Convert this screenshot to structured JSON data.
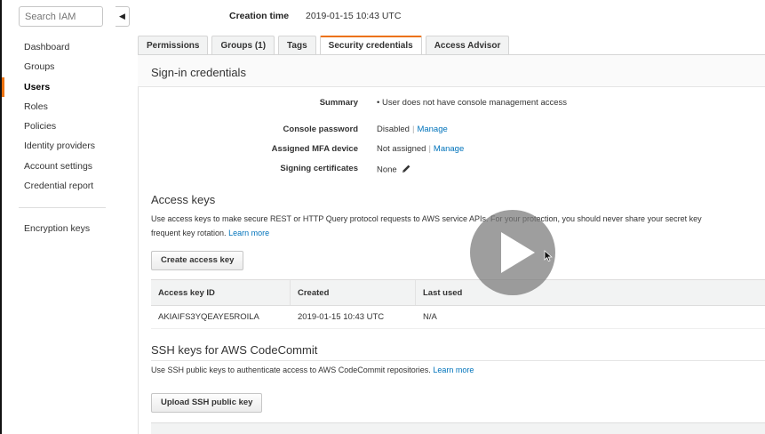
{
  "sidebar": {
    "search_placeholder": "Search IAM",
    "collapse_glyph": "◀",
    "items": [
      {
        "label": "Dashboard"
      },
      {
        "label": "Groups"
      },
      {
        "label": "Users"
      },
      {
        "label": "Roles"
      },
      {
        "label": "Policies"
      },
      {
        "label": "Identity providers"
      },
      {
        "label": "Account settings"
      },
      {
        "label": "Credential report"
      }
    ],
    "active_item": "Users",
    "extra_item": "Encryption keys"
  },
  "header": {
    "creation_label": "Creation time",
    "creation_value": "2019-01-15 10:43 UTC"
  },
  "tabs": [
    {
      "label": "Permissions"
    },
    {
      "label": "Groups (1)"
    },
    {
      "label": "Tags"
    },
    {
      "label": "Security credentials"
    },
    {
      "label": "Access Advisor"
    }
  ],
  "active_tab": "Security credentials",
  "signin": {
    "title": "Sign-in credentials",
    "summary_label": "Summary",
    "summary_value": "•  User does not have console management access",
    "console_password_label": "Console password",
    "console_password_value": "Disabled",
    "console_password_link": "Manage",
    "mfa_label": "Assigned MFA device",
    "mfa_value": "Not assigned",
    "mfa_link": "Manage",
    "signing_label": "Signing certificates",
    "signing_value": "None",
    "edit_icon": "pencil-icon"
  },
  "access_keys": {
    "title": "Access keys",
    "description_line1": "Use access keys to make secure REST or HTTP Query protocol requests to AWS service APIs. For your protection, you should never share your secret key",
    "description_line2": "frequent key rotation.",
    "learn_more": "Learn more",
    "create_button": "Create access key",
    "columns": [
      "Access key ID",
      "Created",
      "Last used"
    ],
    "rows": [
      {
        "id": "AKIAIFS3YQEAYE5ROILA",
        "created": "2019-01-15 10:43 UTC",
        "last_used": "N/A"
      }
    ]
  },
  "ssh": {
    "title": "SSH keys for AWS CodeCommit",
    "description": "Use SSH public keys to authenticate access to AWS CodeCommit repositories.",
    "learn_more": "Learn more",
    "upload_button": "Upload SSH public key"
  },
  "overlay": {
    "play_icon": "play-icon",
    "cursor_icon": "mouse-cursor-icon"
  },
  "colors": {
    "accent": "#ec7211",
    "link": "#0073bb"
  }
}
